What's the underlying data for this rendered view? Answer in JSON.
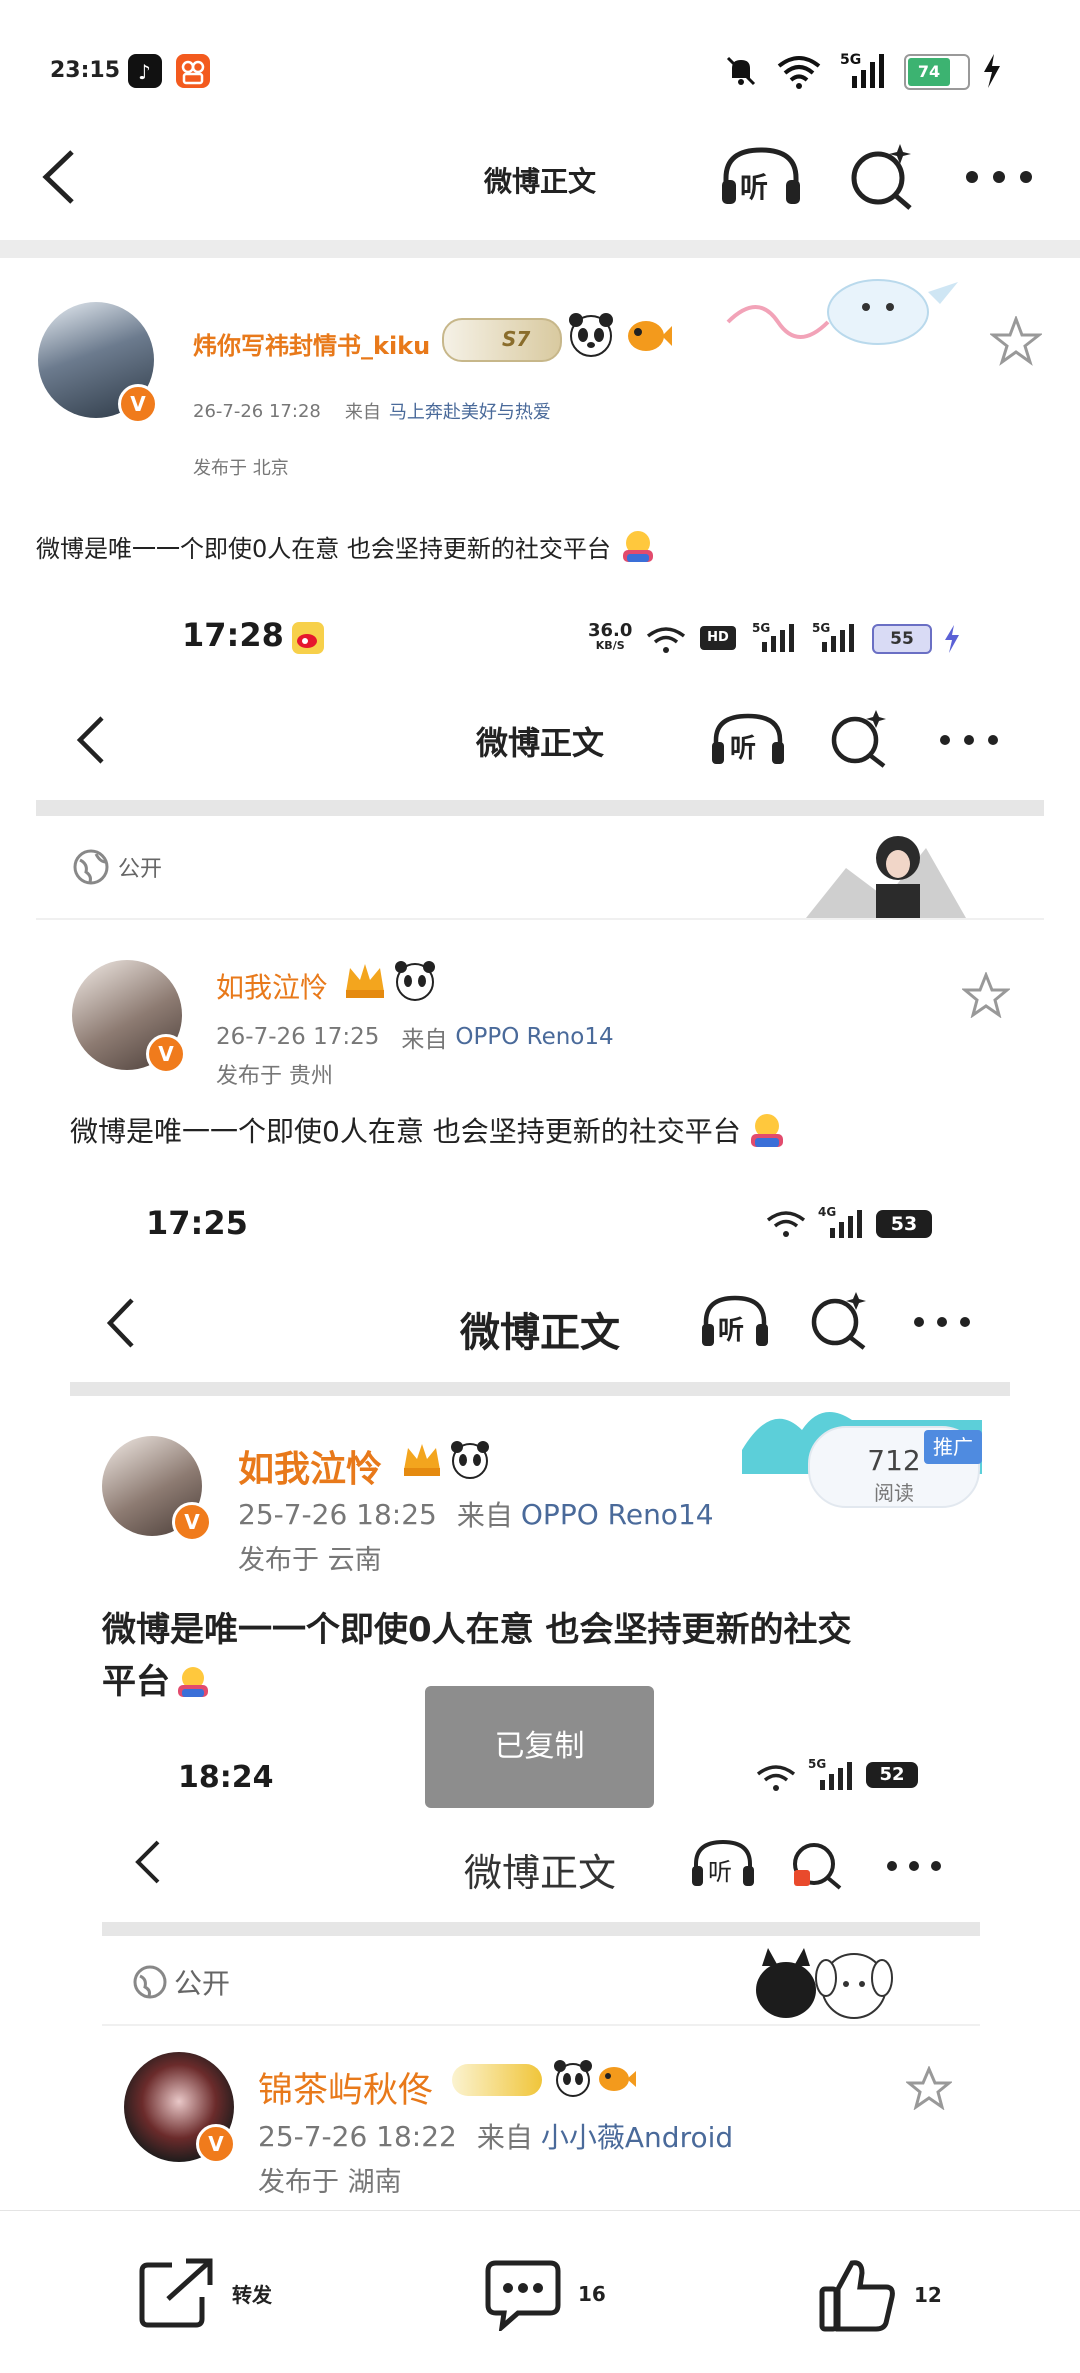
{
  "status_bar": {
    "time": "23:15",
    "battery": "74"
  },
  "nav": {
    "title": "微博正文",
    "listen_label": "听"
  },
  "post": {
    "author": "炜你写祎封情书_kiku",
    "badge_text": "S7",
    "timestamp": "26-7-26 17:28",
    "source_prefix": "来自",
    "source": "马上奔赴美好与热爱",
    "location": "发布于 北京",
    "text": "微博是唯一一个即使0人在意 也会坚持更新的社交平台"
  },
  "shot1": {
    "status_time": "17:28",
    "net_speed": "36.0",
    "net_unit": "KB/S",
    "battery": "55",
    "nav_title": "微博正文",
    "listen_label": "听",
    "visibility": "公开",
    "author": "如我泣怜",
    "timestamp": "26-7-26 17:25",
    "source_prefix": "来自",
    "source": "OPPO Reno14",
    "location": "发布于 贵州",
    "text": "微博是唯一一个即使0人在意 也会坚持更新的社交平台"
  },
  "shot2": {
    "status_time": "17:25",
    "battery": "53",
    "nav_title": "微博正文",
    "listen_label": "听",
    "author": "如我泣怜",
    "timestamp": "25-7-26 18:25",
    "source_prefix": "来自",
    "source": "OPPO Reno14",
    "location": "发布于 云南",
    "text_line1": "微博是唯一一个即使0人在意 也会坚持更新的社交",
    "text_line2": "平台",
    "promo_tag": "推广",
    "read_count": "712",
    "read_label": "阅读"
  },
  "shot3": {
    "status_time": "18:24",
    "battery": "52",
    "nav_title": "微博正文",
    "listen_label": "听",
    "visibility": "公开",
    "author": "锦茶屿秋佟",
    "timestamp": "25-7-26 18:22",
    "source_prefix": "来自",
    "source": "小小薇Android",
    "location": "发布于 湖南"
  },
  "toast": "已复制",
  "bottom_bar": {
    "repost_label": "转发",
    "comment_count": "16",
    "like_count": "12"
  },
  "colors": {
    "accent": "#e8791a",
    "source_link": "#4a6a9a",
    "battery_green": "#3cb371",
    "toast": "#8d8d8d"
  }
}
